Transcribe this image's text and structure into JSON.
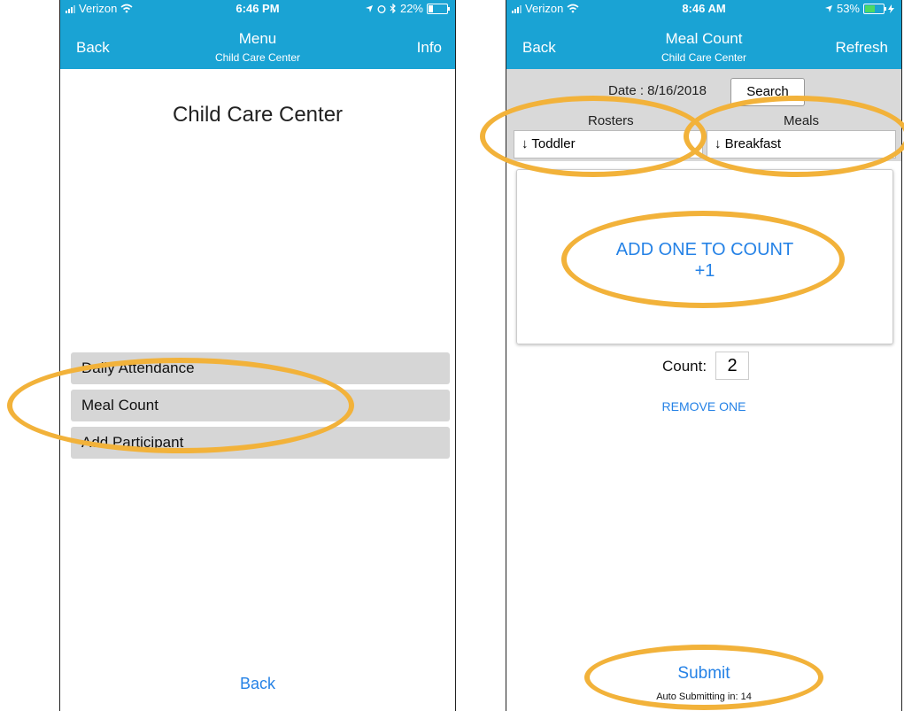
{
  "colors": {
    "nav_bg": "#1aa3d4",
    "link": "#2582e6",
    "highlight": "#f2b23a",
    "button_grey": "#d6d6d6"
  },
  "left_screen": {
    "status_bar": {
      "carrier": "Verizon",
      "time": "6:46 PM",
      "battery": "22%",
      "battery_level": 0.22
    },
    "nav": {
      "back_label": "Back",
      "title": "Menu",
      "subtitle": "Child Care Center",
      "right_label": "Info"
    },
    "page_title": "Child Care Center",
    "menu_items": [
      {
        "label": "Daily Attendance"
      },
      {
        "label": "Meal Count"
      },
      {
        "label": "Add Participant"
      }
    ],
    "bottom_back": "Back"
  },
  "right_screen": {
    "status_bar": {
      "carrier": "Verizon",
      "time": "8:46 AM",
      "battery": "53%",
      "battery_level": 0.53
    },
    "nav": {
      "back_label": "Back",
      "title": "Meal Count",
      "subtitle": "Child Care Center",
      "right_label": "Refresh"
    },
    "date_text": "Date : 8/16/2018",
    "search_label": "Search",
    "rosters": {
      "label": "Rosters",
      "value": "↓ Toddler"
    },
    "meals": {
      "label": "Meals",
      "value": "↓ Breakfast"
    },
    "add_line1": "ADD ONE TO COUNT",
    "add_line2": "+1",
    "count_label": "Count:",
    "count_value": "2",
    "remove_label": "REMOVE ONE",
    "submit_label": "Submit",
    "auto_submit_text": "Auto Submitting in: 14"
  }
}
